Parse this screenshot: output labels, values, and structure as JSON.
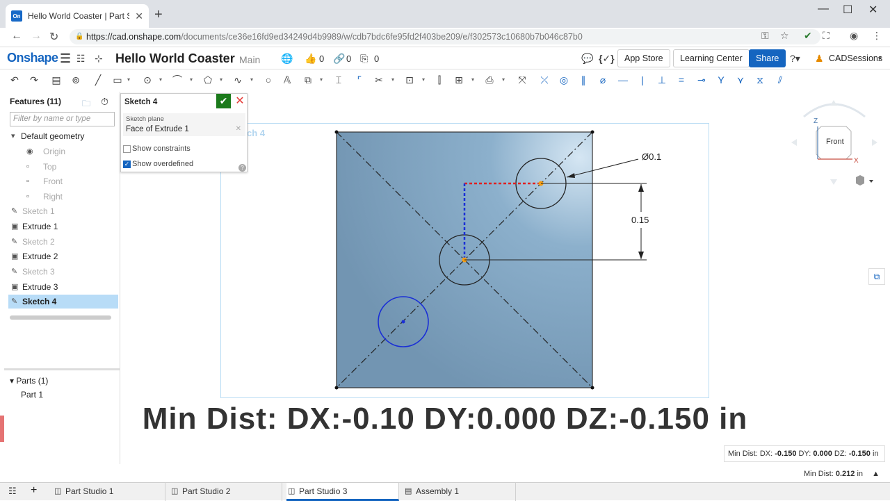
{
  "browser": {
    "tab_title": "Hello World Coaster | Part Studio",
    "url_host": "https://cad.onshape.com",
    "url_path": "/documents/ce36e16fd9ed34249d4b9989/w/cdb7bdc6fe95fd2f403be209/e/f302573c10680b7b046c87b0"
  },
  "header": {
    "logo": "Onshape",
    "doc_title": "Hello World Coaster",
    "branch": "Main",
    "likes": "0",
    "links": "0",
    "copies": "0",
    "app_store": "App Store",
    "learning_center": "Learning Center",
    "share": "Share",
    "user": "CADSessions"
  },
  "features": {
    "title": "Features (11)",
    "filter_placeholder": "Filter by name or type",
    "items": [
      {
        "label": "Default geometry"
      },
      {
        "label": "Origin"
      },
      {
        "label": "Top"
      },
      {
        "label": "Front"
      },
      {
        "label": "Right"
      },
      {
        "label": "Sketch 1"
      },
      {
        "label": "Extrude 1"
      },
      {
        "label": "Sketch 2"
      },
      {
        "label": "Extrude 2"
      },
      {
        "label": "Sketch 3"
      },
      {
        "label": "Extrude 3"
      },
      {
        "label": "Sketch 4"
      }
    ],
    "parts_title": "Parts (1)",
    "part_1": "Part 1"
  },
  "sketch_dialog": {
    "title": "Sketch 4",
    "plane_label": "Sketch plane",
    "plane_value": "Face of Extrude 1",
    "show_constraints": "Show constraints",
    "show_overdefined": "Show overdefined"
  },
  "viewport": {
    "sketch_label": "ch 4",
    "dim_diameter": "Ø0.1",
    "dim_vertical": "0.15",
    "view_label": "Front",
    "axis_z": "Z",
    "axis_x": "X"
  },
  "caption": "Min Dist: DX:-0.10 DY:0.000 DZ:-0.150 in",
  "measure": {
    "line1_prefix": "Min Dist: DX:",
    "dx": "-0.150",
    "dy_label": "DY:",
    "dy": "0.000",
    "dz_label": "DZ:",
    "dz": "-0.150",
    "unit": "in",
    "line2_prefix": "Min Dist:",
    "dist": "0.212",
    "dist_unit": "in"
  },
  "bottom_tabs": [
    {
      "label": "Part Studio 1"
    },
    {
      "label": "Part Studio 2"
    },
    {
      "label": "Part Studio 3"
    },
    {
      "label": "Assembly 1"
    }
  ],
  "colors": {
    "brand": "#1565c0",
    "face": "#7fa3bf",
    "selected": "#b8dcf7",
    "ok": "#1b7a1b"
  }
}
